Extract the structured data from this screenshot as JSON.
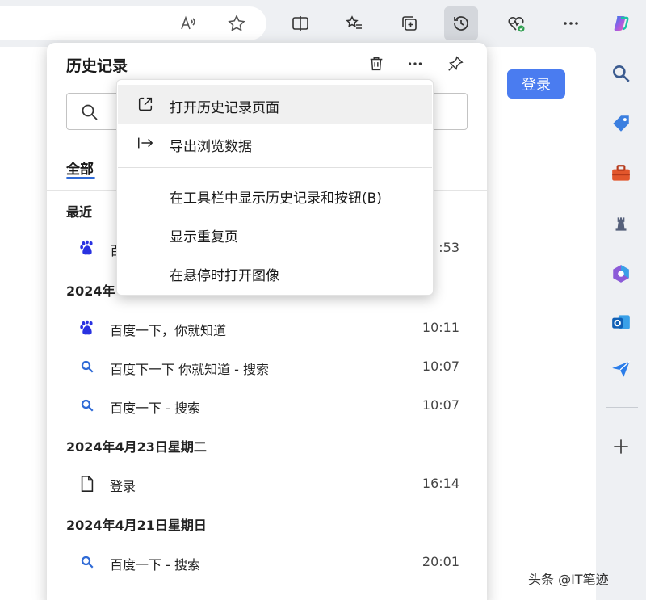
{
  "page": {
    "login_label": "登录"
  },
  "panel": {
    "title": "历史记录",
    "tab_all": "全部",
    "groups": [
      {
        "heading": "最近",
        "items": [
          {
            "title": "百",
            "time": ":53",
            "icon": "baidu-icon"
          }
        ]
      },
      {
        "heading": "2024年",
        "items": [
          {
            "title": "百度一下，你就知道",
            "time": "10:11",
            "icon": "baidu-icon"
          },
          {
            "title": "百度下一下 你就知道 - 搜索",
            "time": "10:07",
            "icon": "search-icon"
          },
          {
            "title": "百度一下 - 搜索",
            "time": "10:07",
            "icon": "search-icon"
          }
        ]
      },
      {
        "heading": "2024年4月23日星期二",
        "items": [
          {
            "title": "登录",
            "time": "16:14",
            "icon": "page-icon"
          }
        ]
      },
      {
        "heading": "2024年4月21日星期日",
        "items": [
          {
            "title": "百度一下 - 搜索",
            "time": "20:01",
            "icon": "search-icon"
          }
        ]
      }
    ]
  },
  "menu": {
    "items": [
      {
        "label": "打开历史记录页面",
        "icon": "open-external-icon"
      },
      {
        "label": "导出浏览数据",
        "icon": "export-icon"
      },
      {
        "label": "在工具栏中显示历史记录和按钮(B)",
        "icon": ""
      },
      {
        "label": "显示重复页",
        "icon": ""
      },
      {
        "label": "在悬停时打开图像",
        "icon": ""
      }
    ]
  },
  "watermark": "头条 @IT笔迹",
  "colors": {
    "accent": "#4a7cf0",
    "tab_underline": "#2f6ad6",
    "search_icon": "#2f6ad6",
    "baidu": "#2932e1"
  }
}
